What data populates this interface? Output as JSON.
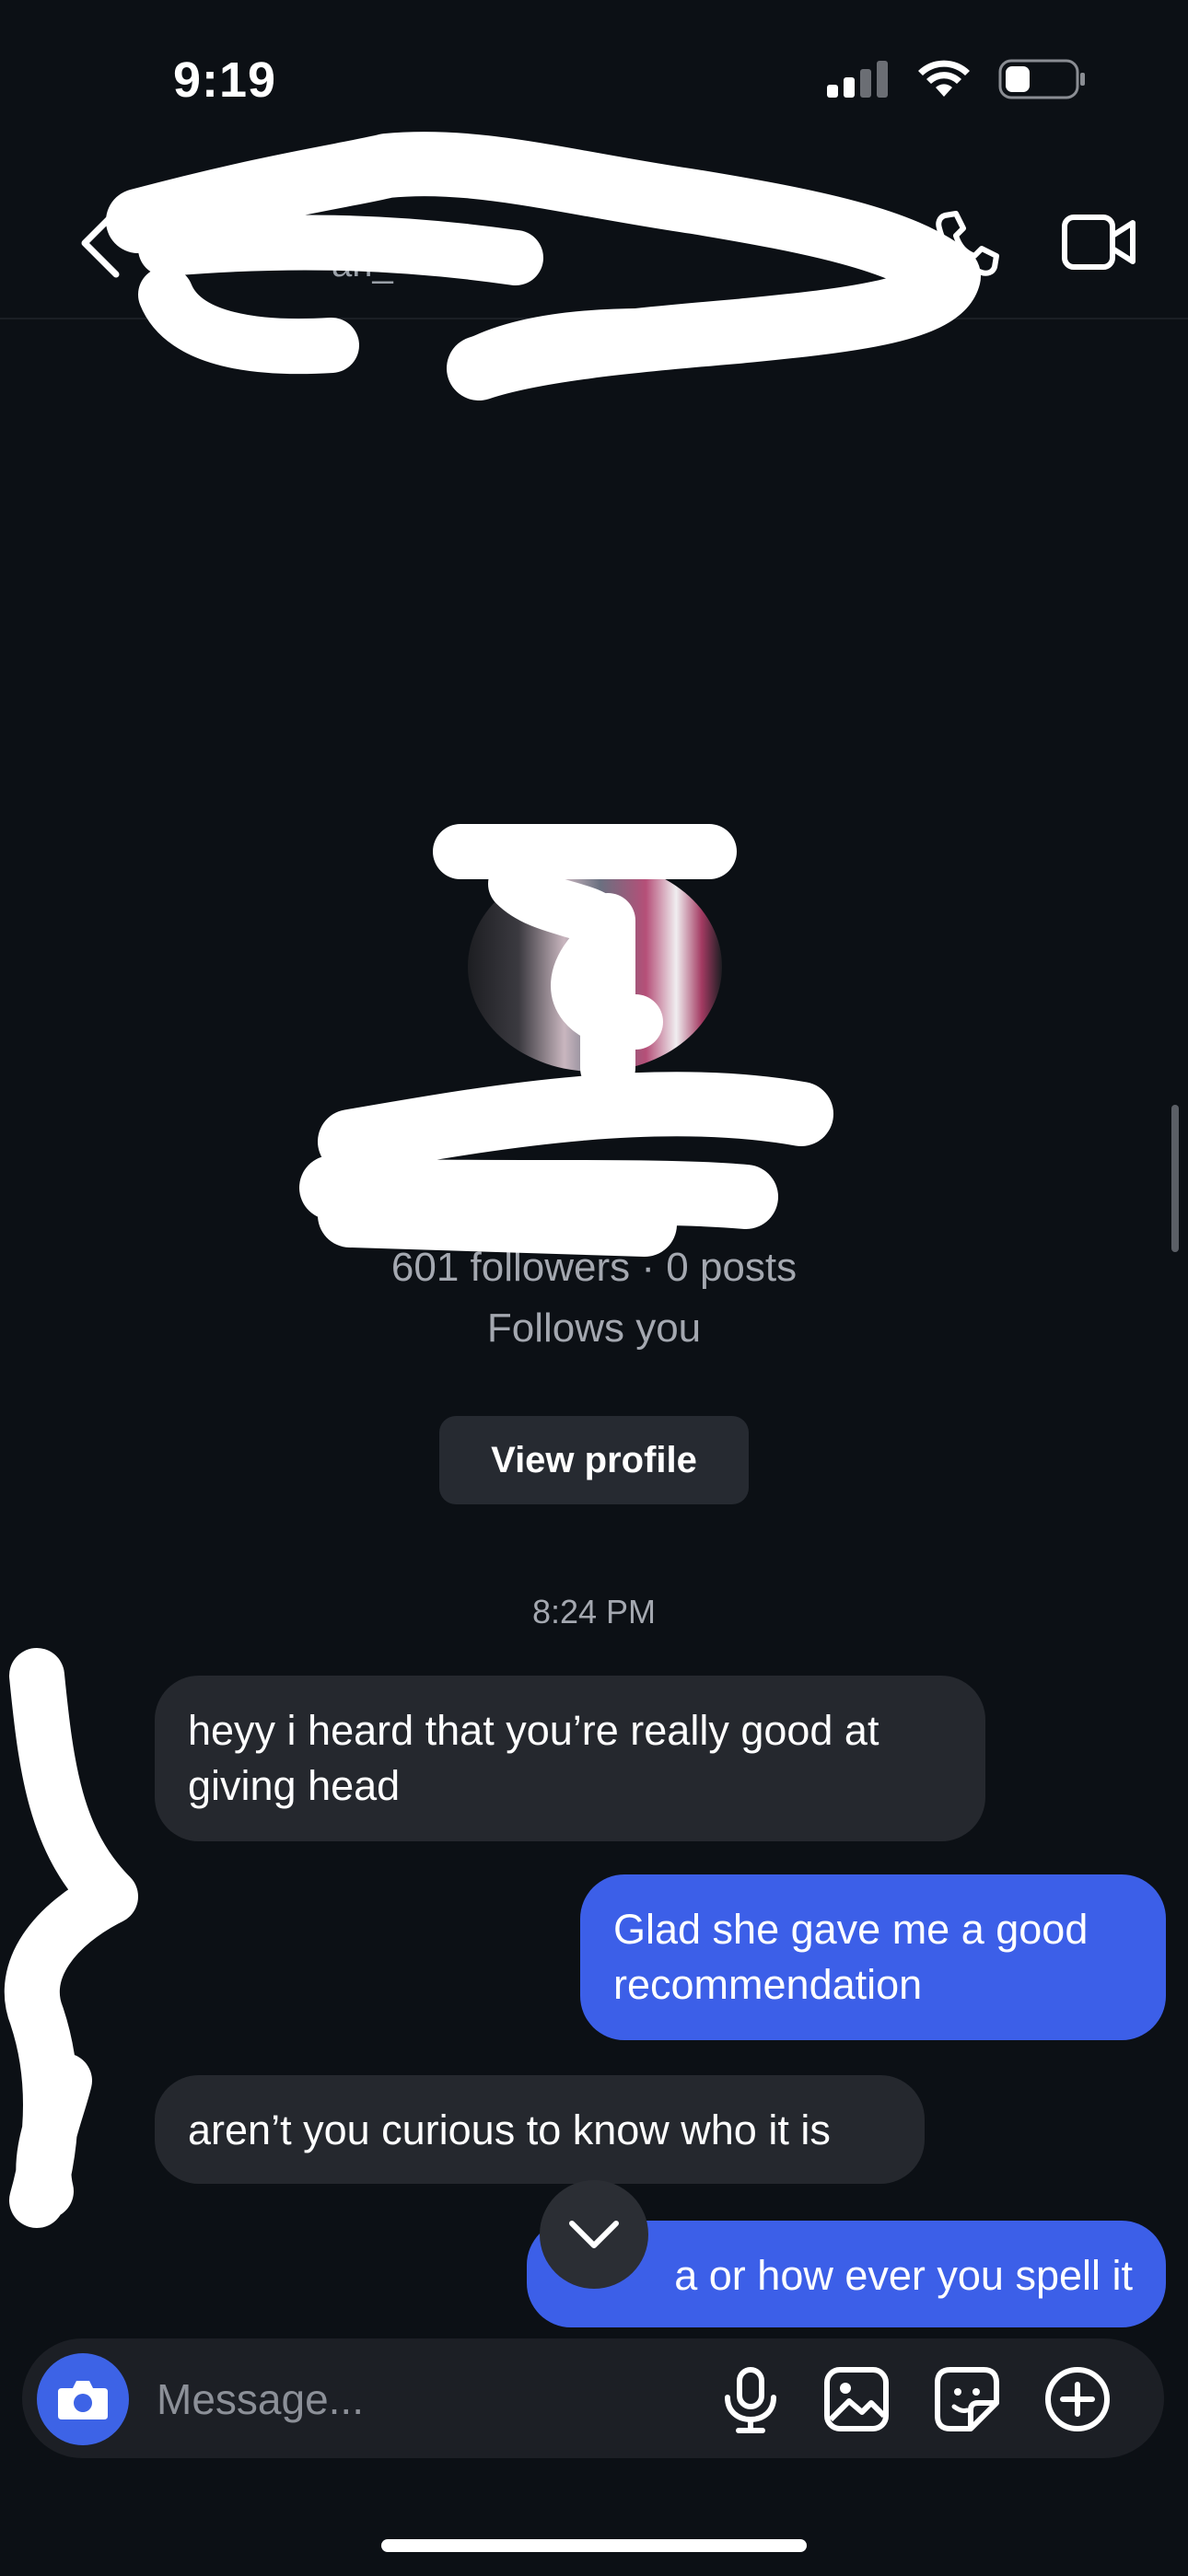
{
  "status_bar": {
    "time": "9:19",
    "icons": [
      "cellular-signal-icon",
      "wifi-icon",
      "battery-icon"
    ]
  },
  "header": {
    "name_visible": "an_",
    "icons": [
      "back-icon",
      "phone-icon",
      "video-camera-icon"
    ]
  },
  "profile": {
    "stats": "601 followers · 0 posts",
    "follows": "Follows you",
    "view_profile_label": "View profile"
  },
  "thread": {
    "timestamp": "8:24 PM",
    "messages": [
      {
        "from": "them",
        "text": "heyy i heard that you’re really good at giving head"
      },
      {
        "from": "me",
        "text": "Glad she gave me a good recommendation"
      },
      {
        "from": "them",
        "text": "aren’t you curious to know who it is"
      },
      {
        "from": "me",
        "text": "a or how ever you spell it"
      }
    ]
  },
  "composer": {
    "placeholder": "Message...",
    "icons": [
      "camera-icon",
      "microphone-icon",
      "gallery-icon",
      "sticker-icon",
      "plus-circle-icon"
    ]
  },
  "colors": {
    "background": "#0c1015",
    "incoming_bubble": "#25282e",
    "outgoing_bubble": "#3c5fe8",
    "accent": "#3d63e6"
  }
}
